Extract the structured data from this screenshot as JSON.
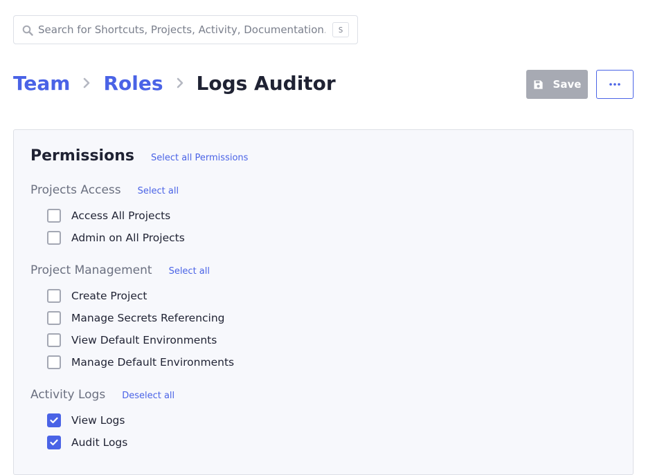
{
  "search": {
    "placeholder": "Search for Shortcuts, Projects, Activity, Documentation...",
    "shortcut_key": "S",
    "icon": "search-icon"
  },
  "breadcrumb": {
    "items": [
      {
        "label": "Team"
      },
      {
        "label": "Roles"
      }
    ],
    "current": "Logs Auditor",
    "separator_icon": "chevron-right-icon"
  },
  "toolbar": {
    "save_label": "Save",
    "save_icon": "floppy-disk-icon",
    "more_icon": "ellipsis-icon"
  },
  "permissions": {
    "title": "Permissions",
    "select_all_label": "Select all Permissions",
    "groups": [
      {
        "title": "Projects Access",
        "action_label": "Select all",
        "items": [
          {
            "label": "Access All Projects",
            "checked": false
          },
          {
            "label": "Admin on All Projects",
            "checked": false
          }
        ]
      },
      {
        "title": "Project Management",
        "action_label": "Select all",
        "items": [
          {
            "label": "Create Project",
            "checked": false
          },
          {
            "label": "Manage Secrets Referencing",
            "checked": false
          },
          {
            "label": "View Default Environments",
            "checked": false
          },
          {
            "label": "Manage Default Environments",
            "checked": false
          }
        ]
      },
      {
        "title": "Activity Logs",
        "action_label": "Deselect all",
        "items": [
          {
            "label": "View Logs",
            "checked": true
          },
          {
            "label": "Audit Logs",
            "checked": true
          }
        ]
      }
    ]
  },
  "colors": {
    "accent": "#4a63e6",
    "save_disabled": "#a7aab3",
    "panel_bg": "#f7f8fc"
  }
}
